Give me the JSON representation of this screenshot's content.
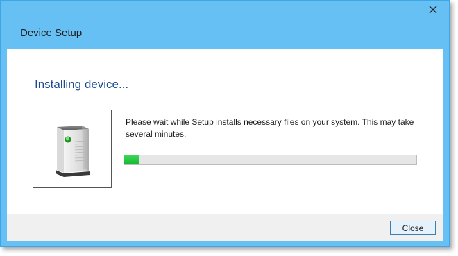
{
  "window": {
    "title": "Device Setup",
    "close_glyph": "✕",
    "frame_color": "#67c0f3"
  },
  "main": {
    "heading": "Installing device...",
    "heading_color": "#1a4b93",
    "message": "Please wait while Setup installs necessary files on your system. This may take several minutes.",
    "device_icon": "device-tower-icon",
    "progress_percent": 5,
    "progress_color": "#12b82f"
  },
  "footer": {
    "close_label": "Close"
  }
}
